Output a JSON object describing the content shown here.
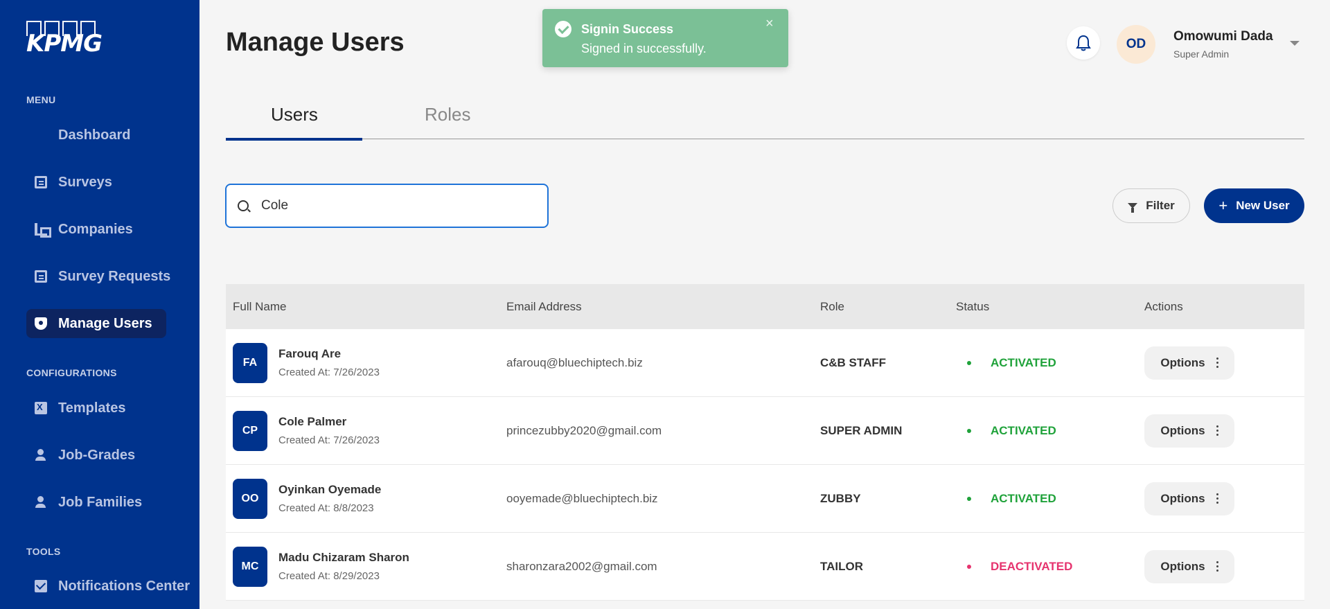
{
  "sidebar": {
    "logo_text": "KPMG",
    "menu_title": "MENU",
    "menu_items": [
      {
        "label": "Dashboard",
        "icon": "dashboard-icon"
      },
      {
        "label": "Surveys",
        "icon": "survey-icon"
      },
      {
        "label": "Companies",
        "icon": "building-icon"
      },
      {
        "label": "Survey Requests",
        "icon": "request-icon"
      },
      {
        "label": "Manage Users",
        "icon": "shield-user-icon",
        "active": true
      }
    ],
    "config_title": "CONFIGURATIONS",
    "config_items": [
      {
        "label": "Templates",
        "icon": "excel-icon"
      },
      {
        "label": "Job-Grades",
        "icon": "person-icon"
      },
      {
        "label": "Job Families",
        "icon": "person-icon"
      }
    ],
    "tools_title": "TOOLS",
    "tools_items": [
      {
        "label": "Notifications Center",
        "icon": "mail-icon"
      }
    ]
  },
  "header": {
    "title": "Manage Users",
    "user_initials": "OD",
    "user_name": "Omowumi Dada",
    "user_role": "Super Admin"
  },
  "toast": {
    "title": "Signin Success",
    "message": "Signed in successfully.",
    "close": "×"
  },
  "tabs": [
    {
      "label": "Users",
      "active": true
    },
    {
      "label": "Roles",
      "active": false
    }
  ],
  "search": {
    "value": "Cole",
    "placeholder": "Search"
  },
  "toolbar": {
    "filter_label": "Filter",
    "new_user_label": "New User"
  },
  "table": {
    "headers": [
      "Full Name",
      "Email Address",
      "Role",
      "Status",
      "Actions"
    ],
    "rows": [
      {
        "initials": "FA",
        "name": "Farouq Are",
        "created": "Created At: 7/26/2023",
        "email": "afarouq@bluechiptech.biz",
        "role": "C&B STAFF",
        "status": "ACTIVATED",
        "options": "Options"
      },
      {
        "initials": "CP",
        "name": "Cole Palmer",
        "created": "Created At: 7/26/2023",
        "email": "princezubby2020@gmail.com",
        "role": "SUPER ADMIN",
        "status": "ACTIVATED",
        "options": "Options"
      },
      {
        "initials": "OO",
        "name": "Oyinkan Oyemade",
        "created": "Created At: 8/8/2023",
        "email": "ooyemade@bluechiptech.biz",
        "role": "ZUBBY",
        "status": "ACTIVATED",
        "options": "Options"
      },
      {
        "initials": "MC",
        "name": "Madu Chizaram Sharon",
        "created": "Created At: 8/29/2023",
        "email": "sharonzara2002@gmail.com",
        "role": "TAILOR",
        "status": "DEACTIVATED",
        "options": "Options"
      }
    ]
  },
  "colors": {
    "sidebar": "#00338d",
    "accent": "#00338d",
    "toast": "#7bc096",
    "activated": "#1fa23a",
    "deactivated": "#e6336e"
  }
}
